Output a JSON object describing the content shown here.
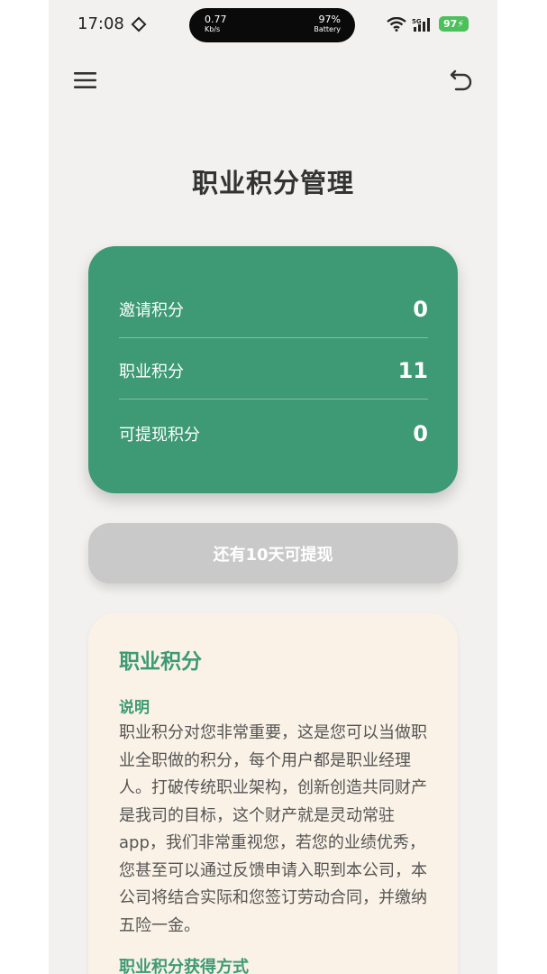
{
  "status_bar": {
    "time": "17:08",
    "net_speed": "0.77",
    "net_unit": "Kb/s",
    "battery_percent": "97%",
    "battery_label": "Battery",
    "battery_level": "97"
  },
  "page": {
    "title": "职业积分管理"
  },
  "points": {
    "invite_label": "邀请积分",
    "invite_value": "0",
    "career_label": "职业积分",
    "career_value": "11",
    "withdrawable_label": "可提现积分",
    "withdrawable_value": "0"
  },
  "withdraw_button": {
    "label": "还有10天可提现"
  },
  "info": {
    "title": "职业积分",
    "subtitle": "说明",
    "body": "职业积分对您非常重要，这是您可以当做职业全职做的积分，每个用户都是职业经理人。打破传统职业架构，创新创造共同财产是我司的目标，这个财产就是灵动常驻app，我们非常重视您，若您的业绩优秀，您甚至可以通过反馈申请入职到本公司，本公司将结合实际和您签订劳动合同，并缴纳五险一金。",
    "subtitle2": "职业积分获得方式"
  },
  "colors": {
    "accent_green": "#3d9a74",
    "disabled_button": "#c9c9c9",
    "info_bg": "#faf2e7",
    "page_bg": "#f2f1ef"
  },
  "icons": {
    "menu": "menu-icon",
    "back": "back-icon",
    "wifi": "wifi-icon",
    "signal": "signal-icon",
    "battery": "battery-icon"
  }
}
